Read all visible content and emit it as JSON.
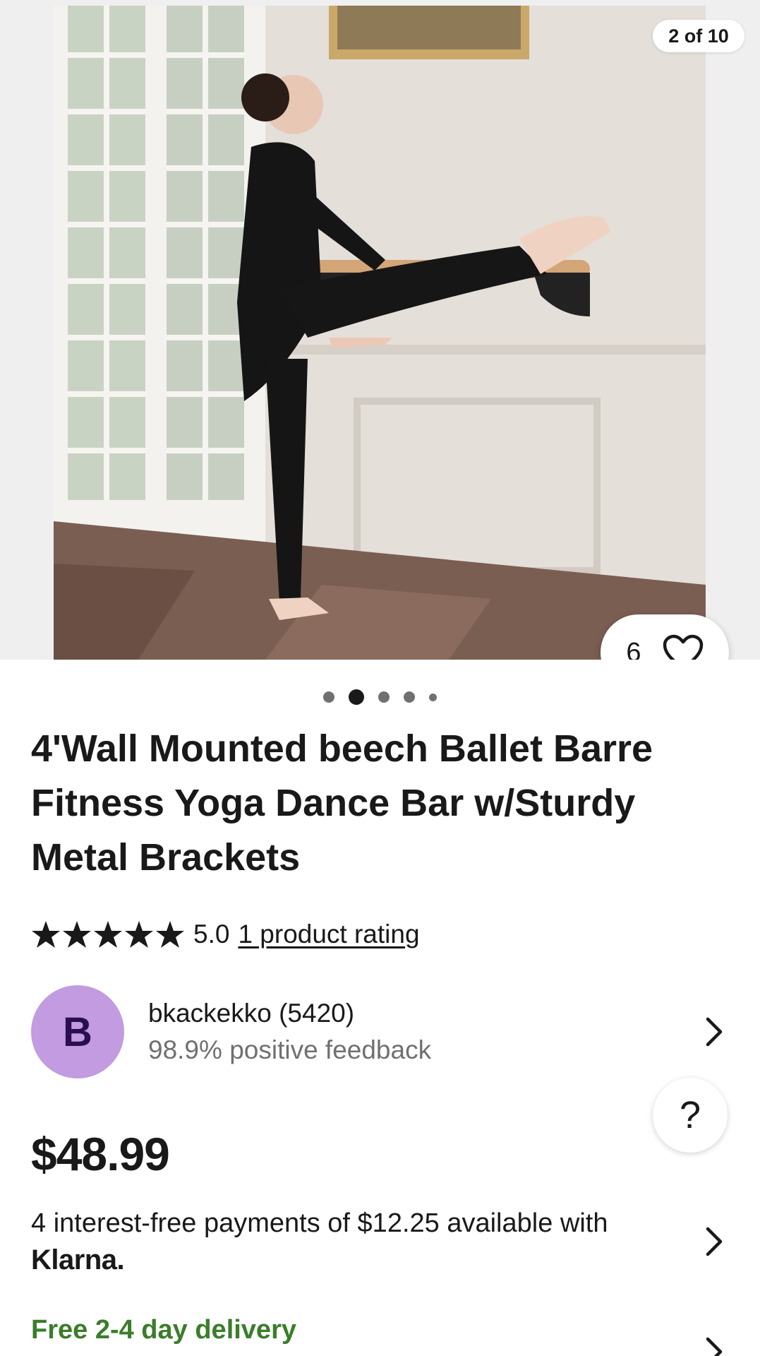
{
  "gallery": {
    "counter": "2 of 10",
    "watch_count": "6",
    "dots_total": 5,
    "active_dot": 2
  },
  "product": {
    "title": "4'Wall Mounted beech Ballet Barre Fitness Yoga Dance Bar w/Sturdy Metal Brackets",
    "rating_value": "5.0",
    "rating_stars": 5,
    "rating_link": "1 product rating",
    "price": "$48.99"
  },
  "seller": {
    "initial": "B",
    "name": "bkackekko (5420)",
    "feedback": "98.9% positive feedback"
  },
  "payments": {
    "text": "4 interest-free payments of $12.25 available with",
    "provider": "Klarna."
  },
  "shipping": {
    "delivery": "Free 2-4 day delivery"
  },
  "help": {
    "label": "?"
  },
  "colors": {
    "avatar_bg": "#c29be0",
    "avatar_text": "#2b0d52",
    "delivery_green": "#3a7d2a",
    "text_primary": "#191919",
    "text_secondary": "#707070"
  }
}
